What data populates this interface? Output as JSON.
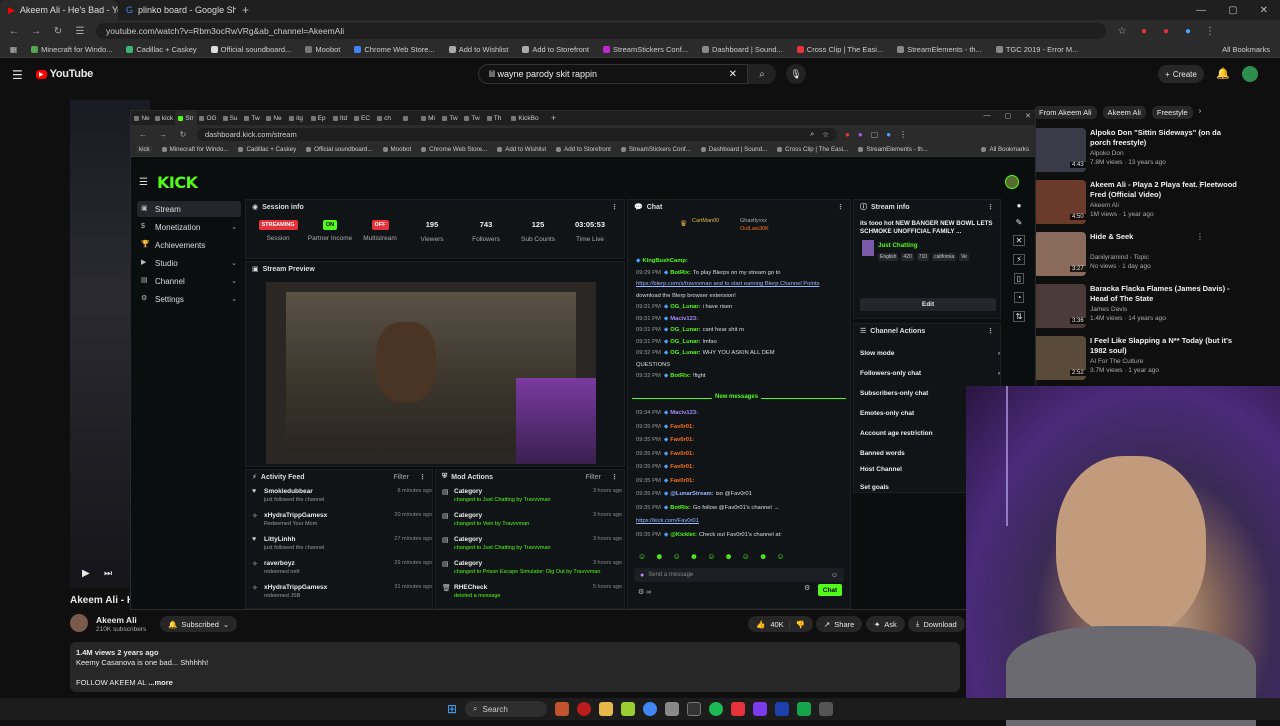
{
  "outer_browser": {
    "tabs": [
      {
        "title": "Akeem Ali - He's Bad - YouTube",
        "active": true
      },
      {
        "title": "plinko board - Google Shoppin",
        "active": false
      }
    ],
    "new_tab": "+",
    "url": "youtube.com/watch?v=Rbm3ocRwVRg&ab_channel=AkeemAli",
    "bookmarks": [
      "Minecraft for Windo...",
      "Cadillac + Caskey",
      "Official soundboard...",
      "Moobot",
      "Chrome Web Store...",
      "Add to Wishlist",
      "Add to Storefront",
      "StreamStickers Conf...",
      "Dashboard | Sound...",
      "Cross Clip | The Easi...",
      "StreamElements - th...",
      "TGC 2019 - Error M..."
    ],
    "all_bookmarks": "All Bookmarks"
  },
  "youtube": {
    "logo": "YouTube",
    "search_value": "lil wayne parody skit  rappin",
    "create_label": "Create",
    "chips": [
      "From Akeem Ali",
      "Akeem Ali",
      "Freestyle"
    ],
    "video_title_partial": "Akeem Ali - H",
    "channel": "Akeem Ali",
    "subscribers": "210K subscribers",
    "subscribed_label": "Subscribed",
    "likes": "40K",
    "share": "Share",
    "ask": "Ask",
    "download": "Download",
    "views_meta": "1.4M views  2 years ago",
    "desc_line": "Keemy Casanova is one bad... Shhhhh!",
    "desc_line2": "FOLLOW AKEEM AL",
    "more": "...more",
    "sidebar": [
      {
        "title": "Alpoko Don \"Sittin Sideways\" (on da porch freestyle)",
        "channel": "Alpoko Don",
        "meta": "7.8M views · 13 years ago",
        "dur": "4:43",
        "color": "#3a3a48"
      },
      {
        "title": "Akeem Ali - Playa 2 Playa feat. Fleetwood Fred (Official Video)",
        "channel": "Akeem Ali",
        "meta": "1M views · 1 year ago",
        "dur": "4:50",
        "color": "#6a3a2a"
      },
      {
        "title": "Hide & Seek",
        "channel": "Danilyramind - Topic",
        "meta": "No views · 1 day ago",
        "dur": "3:27",
        "color": "#8a6a5a"
      },
      {
        "title": "Baracka Flacka Flames (James Davis) - Head of The State",
        "channel": "James Davis",
        "meta": "1.4M views · 14 years ago",
        "dur": "3:36",
        "color": "#4a3a3a"
      },
      {
        "title": "I Feel Like Slapping a N** Today (but it's 1982 soul)",
        "channel": "AI For The Culture",
        "meta": "3.7M views · 1 year ago",
        "dur": "2:52",
        "color": "#5a4a3a"
      }
    ]
  },
  "kick_browser": {
    "url": "dashboard.kick.com/stream",
    "bookmarks": [
      "Minecraft for Windo...",
      "Cadillac + Caskey",
      "Official soundboard...",
      "Moobot",
      "Chrome Web Store...",
      "Add to Wishlist",
      "Add to Storefront",
      "StreamStickers Conf...",
      "Dashboard | Sound...",
      "Cross Clip | The Easi...",
      "StreamElements - th...",
      "All Bookmarks"
    ],
    "tab_labels": [
      "Ne",
      "kick",
      "Str",
      "OG",
      "Su",
      "Tw",
      "Ne",
      "itg",
      "Ep",
      "Itd",
      "EC",
      "ch",
      "",
      "Mi",
      "Tw",
      "Tw",
      "Th",
      "KickBo"
    ]
  },
  "kick": {
    "logo": "KICK",
    "nav": [
      {
        "label": "Stream",
        "active": true,
        "chevron": false
      },
      {
        "label": "Monetization",
        "active": false,
        "chevron": true
      },
      {
        "label": "Achievements",
        "active": false,
        "chevron": false
      },
      {
        "label": "Studio",
        "active": false,
        "chevron": true
      },
      {
        "label": "Channel",
        "active": false,
        "chevron": true
      },
      {
        "label": "Settings",
        "active": false,
        "chevron": true
      }
    ],
    "session": {
      "title": "Session info",
      "stats": [
        {
          "badge": "STREAMING",
          "badge_color": "#e5323b",
          "label": "Session"
        },
        {
          "badge": "ON",
          "badge_color": "#53fc18",
          "label": "Partner Income"
        },
        {
          "badge": "OFF",
          "badge_color": "#e5323b",
          "label": "Multistream"
        },
        {
          "value": "195",
          "label": "Viewers"
        },
        {
          "value": "743",
          "label": "Followers"
        },
        {
          "value": "125",
          "label": "Sub Counts"
        },
        {
          "value": "03:05:53",
          "label": "Time Live"
        }
      ]
    },
    "preview_title": "Stream Preview",
    "activity": {
      "title": "Activity Feed",
      "filter": "Filter",
      "rows": [
        {
          "icon": "heart",
          "name": "Smokiedubbear",
          "sub": "just followed the channel",
          "time": "8 minutes ago"
        },
        {
          "icon": "gift",
          "name": "xHydraTrippGamesx",
          "sub": "Redeemed Your Mom",
          "time": "20 minutes ago"
        },
        {
          "icon": "heart",
          "name": "LittyLinhh",
          "sub": "just followed the channel",
          "time": "27 minutes ago"
        },
        {
          "icon": "gift",
          "name": "raverboyz",
          "sub": "redeemed nett",
          "time": "29 minutes ago"
        },
        {
          "icon": "gift",
          "name": "xHydraTrippGamesx",
          "sub": "redeemed JSB",
          "time": "31 minutes ago"
        }
      ]
    },
    "mod": {
      "title": "Mod Actions",
      "filter": "Filter",
      "rows": [
        {
          "name": "Category",
          "sub": "changed to Just Chatting by Travvvman",
          "time": "3 hours ago"
        },
        {
          "name": "Category",
          "sub": "changed to Vein by Travvvman",
          "time": "3 hours ago"
        },
        {
          "name": "Category",
          "sub": "changed to Just Chatting by Travvvman",
          "time": "3 hours ago"
        },
        {
          "name": "Category",
          "sub": "changed to Prison Escape Simulator: Dig Out by Travvvman",
          "time": "3 hours ago"
        },
        {
          "name": "RHECheck",
          "sub": "deleted a message",
          "time": "5 hours ago"
        }
      ]
    },
    "chat": {
      "title": "Chat",
      "top_users": [
        "CartMan00",
        "Ghastlyvxx",
        "OutLaw30K"
      ],
      "lines": [
        {
          "ts": "",
          "user": "KingBushCamp:",
          "ucolor": "#53fc18",
          "text": ""
        },
        {
          "ts": "09:29 PM",
          "user": "BotRix:",
          "ucolor": "#53fc18",
          "text": "To play Blerps on my stream go to"
        },
        {
          "ts": "",
          "user": "",
          "ucolor": "#9ab8ff",
          "text": "https://blerp.com/x/travvvman and to start earning Blerp Channel Points"
        },
        {
          "ts": "",
          "user": "",
          "ucolor": "#ddd",
          "text": "download the Blerp browser extension!"
        },
        {
          "ts": "09:31 PM",
          "user": "OG_Lunar:",
          "ucolor": "#53fc18",
          "text": "i have risen"
        },
        {
          "ts": "09:31 PM",
          "user": "Maciv123:",
          "ucolor": "#a78bfa",
          "text": ""
        },
        {
          "ts": "09:31 PM",
          "user": "OG_Lunar:",
          "ucolor": "#53fc18",
          "text": "cant hear shit rn"
        },
        {
          "ts": "09:31 PM",
          "user": "OG_Lunar:",
          "ucolor": "#53fc18",
          "text": "lmfao"
        },
        {
          "ts": "09:32 PM",
          "user": "OG_Lunar:",
          "ucolor": "#53fc18",
          "text": "WHY YOU ASKIN ALL DEM"
        },
        {
          "ts": "",
          "user": "",
          "ucolor": "#ddd",
          "text": "QUESTIONS"
        },
        {
          "ts": "09:32 PM",
          "user": "BotRix:",
          "ucolor": "#53fc18",
          "text": "!fight"
        }
      ],
      "new_messages": "New messages",
      "lines2": [
        {
          "ts": "09:34 PM",
          "user": "Maciv123:",
          "ucolor": "#a78bfa",
          "text": ""
        },
        {
          "ts": "09:35 PM",
          "user": "Fav0r01:",
          "ucolor": "#f97316",
          "text": ""
        },
        {
          "ts": "09:35 PM",
          "user": "Fav0r01:",
          "ucolor": "#f97316",
          "text": ""
        },
        {
          "ts": "09:35 PM",
          "user": "Fav0r01:",
          "ucolor": "#f97316",
          "text": ""
        },
        {
          "ts": "09:35 PM",
          "user": "Fav0r01:",
          "ucolor": "#f97316",
          "text": ""
        },
        {
          "ts": "09:35 PM",
          "user": "Fav0r01:",
          "ucolor": "#f97316",
          "text": ""
        },
        {
          "ts": "09:35 PM",
          "user": "@LunarStream:",
          "ucolor": "#9ab8ff",
          "text": "iso @Fav0r01"
        },
        {
          "ts": "09:35 PM",
          "user": "BotRix:",
          "ucolor": "#53fc18",
          "text": "Go follow @Fav0r01's channel →"
        },
        {
          "ts": "",
          "user": "",
          "ucolor": "#9ab8ff",
          "text": "https://kick.com/Fav0r01"
        },
        {
          "ts": "09:35 PM",
          "user": "@Kicklet:",
          "ucolor": "#53fc18",
          "text": "Check out Fav0r01's channel at:"
        }
      ],
      "placeholder": "Send a message",
      "send": "Chat"
    },
    "stream_info": {
      "title": "Stream info",
      "stream_title": "its tooo hot NEW BANGER NEW BOWL LETS SCHMOKE UNOFFICIAL FAMILY ...",
      "category": "Just Chatting",
      "tags": [
        "English",
        "420",
        "710",
        "california",
        "Ve"
      ],
      "edit": "Edit"
    },
    "channel_actions": {
      "title": "Channel Actions",
      "items": [
        {
          "label": "Slow mode",
          "chevron": true
        },
        {
          "label": "Followers-only chat",
          "chevron": true
        },
        {
          "label": "Subscribers-only chat",
          "chevron": false
        },
        {
          "label": "Emotes-only chat",
          "chevron": false
        },
        {
          "label": "Account age restriction",
          "chevron": false
        },
        {
          "label": "Banned words",
          "chevron": false
        },
        {
          "label": "Host Channel",
          "chevron": false
        },
        {
          "label": "Set goals",
          "chevron": false
        }
      ]
    }
  },
  "taskbar": {
    "search": "Search"
  }
}
